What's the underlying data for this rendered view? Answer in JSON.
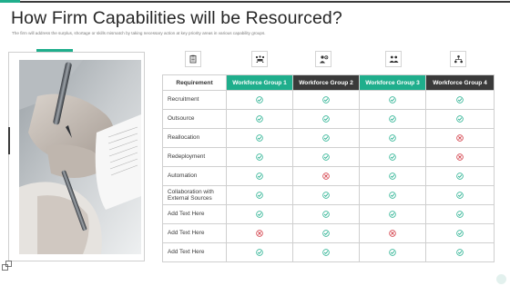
{
  "slide": {
    "title": "How Firm Capabilities will be Resourced?",
    "subtitle": "The firm will address the surplus, shortage or skills mismatch by taking necessary action at key priority areas in various capability groups."
  },
  "colors": {
    "accent": "#1fae8c",
    "dark": "#3a3a3a",
    "check": "#1fae8c",
    "cross": "#d0303b"
  },
  "table": {
    "headers": [
      "Requirement",
      "Workforce Group 1",
      "Workforce Group 2",
      "Workforce Group 3",
      "Workforce Group 4"
    ],
    "header_icons": [
      "clipboard-icon",
      "team-meeting-icon",
      "person-gear-icon",
      "team-pair-icon",
      "network-people-icon"
    ],
    "rows": [
      {
        "label": "Recruitment",
        "marks": [
          "check",
          "check",
          "check",
          "check"
        ]
      },
      {
        "label": "Outsource",
        "marks": [
          "check",
          "check",
          "check",
          "check"
        ]
      },
      {
        "label": "Reallocation",
        "marks": [
          "check",
          "check",
          "check",
          "cross"
        ]
      },
      {
        "label": "Redeployment",
        "marks": [
          "check",
          "check",
          "check",
          "cross"
        ]
      },
      {
        "label": "Automation",
        "marks": [
          "check",
          "cross",
          "check",
          "check"
        ]
      },
      {
        "label": "Collaboration with\nExternal Sources",
        "marks": [
          "check",
          "check",
          "check",
          "check"
        ]
      },
      {
        "label": "Add Text Here",
        "marks": [
          "check",
          "check",
          "check",
          "check"
        ]
      },
      {
        "label": "Add Text Here",
        "marks": [
          "cross",
          "check",
          "cross",
          "check"
        ]
      },
      {
        "label": "Add Text Here",
        "marks": [
          "check",
          "check",
          "check",
          "check"
        ]
      }
    ]
  }
}
